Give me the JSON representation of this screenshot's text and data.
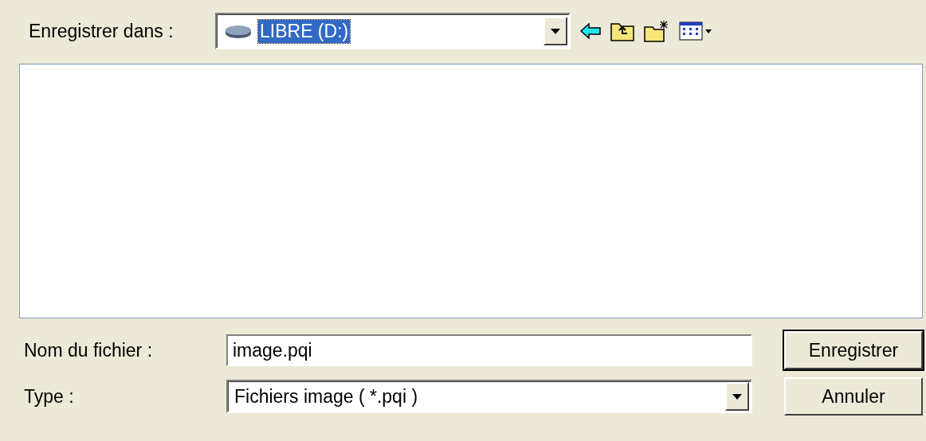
{
  "save_in": {
    "label": "Enregistrer dans :",
    "location": {
      "text": "LIBRE (D:)",
      "selected": true
    }
  },
  "file_name": {
    "label": "Nom du fichier :",
    "value": "image.pqi"
  },
  "file_type": {
    "label": "Type :",
    "value": "Fichiers image ( *.pqi )"
  },
  "buttons": [
    {
      "label": "Enregistrer",
      "default": true
    },
    {
      "label": "Annuler",
      "default": false
    }
  ]
}
